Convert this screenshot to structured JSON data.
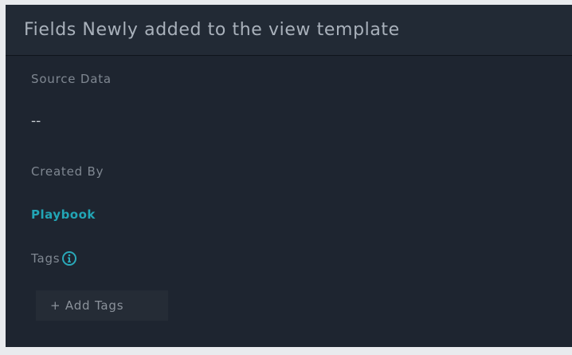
{
  "panel": {
    "title": "Fields Newly added to the view template"
  },
  "fields": {
    "source_data": {
      "label": "Source Data",
      "value": "--"
    },
    "created_by": {
      "label": "Created By",
      "value": "Playbook"
    },
    "tags": {
      "label": "Tags",
      "info_icon": "info-icon",
      "add_button": "+ Add Tags"
    }
  },
  "colors": {
    "panel_background": "#1e2530",
    "header_background": "#222a35",
    "accent": "#22a5b5",
    "label_text": "#7f8791"
  }
}
